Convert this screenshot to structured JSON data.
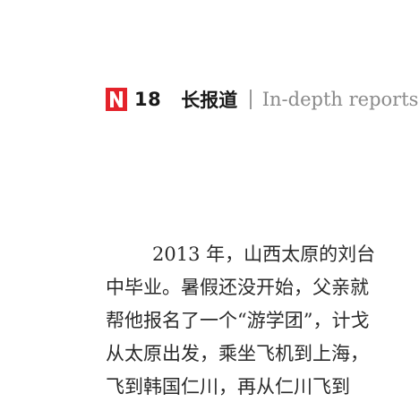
{
  "header": {
    "logo_icon": "n-logo-icon",
    "logo_color": "#e4232b",
    "page_number": "18",
    "section_cn": "长报道",
    "section_en": "In-depth reports"
  },
  "article": {
    "lines": [
      "2013 年，山西太原的刘台",
      "中毕业。暑假还没开始，父亲就",
      "帮他报名了一个“游学团”，计戈",
      "从太原出发，乘坐飞机到上海，",
      "飞到韩国仁川，再从仁川飞到"
    ]
  }
}
